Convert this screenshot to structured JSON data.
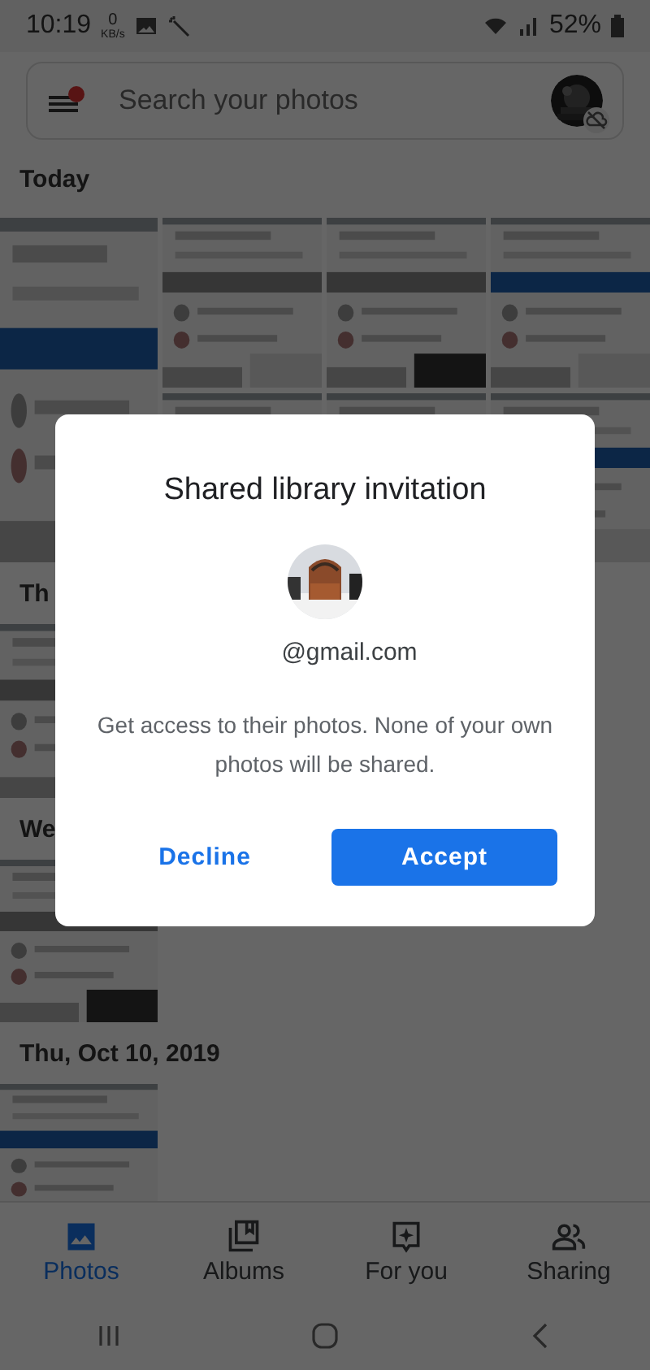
{
  "status_bar": {
    "time": "10:19",
    "data_speed": "0",
    "data_unit": "KB/s",
    "battery": "52%"
  },
  "search": {
    "placeholder": "Search your photos"
  },
  "sections": [
    {
      "title": "Today"
    },
    {
      "title": "Th"
    },
    {
      "title": "We"
    },
    {
      "title": "Thu, Oct 10, 2019"
    }
  ],
  "dialog": {
    "title": "Shared library invitation",
    "email": "@gmail.com",
    "message": "Get access to their photos. None of your own photos will be shared.",
    "buttons": [
      {
        "label": "Decline",
        "kind": "text"
      },
      {
        "label": "Accept",
        "kind": "filled"
      }
    ]
  },
  "nav": [
    {
      "label": "Photos",
      "selected": true
    },
    {
      "label": "Albums",
      "selected": false
    },
    {
      "label": "For you",
      "selected": false
    },
    {
      "label": "Sharing",
      "selected": false
    }
  ]
}
